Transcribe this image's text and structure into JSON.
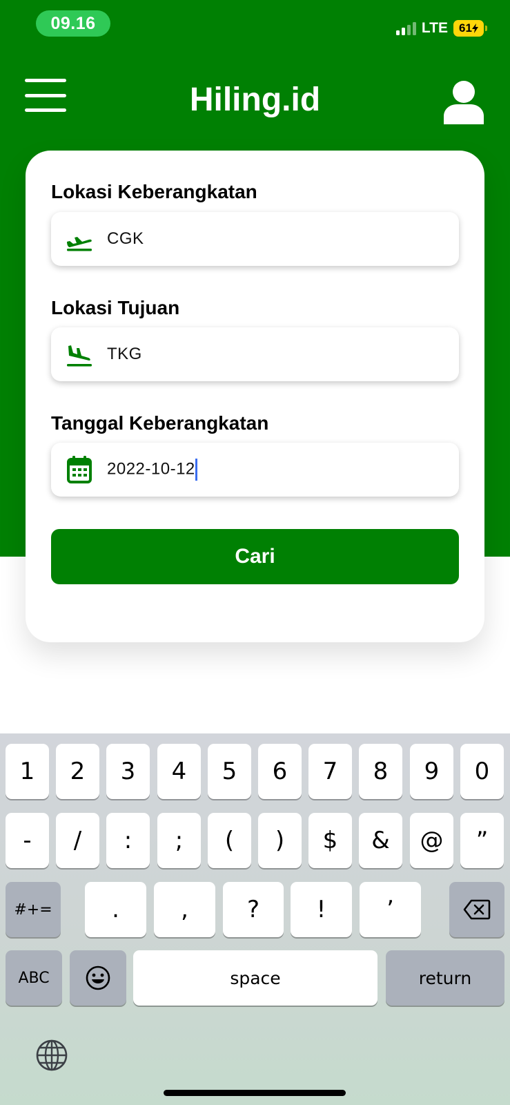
{
  "status_bar": {
    "time": "09.16",
    "network": "LTE",
    "battery": "61"
  },
  "app_bar": {
    "title": "Hiling.id",
    "menu_icon": "hamburger-menu-icon",
    "profile_icon": "user-icon"
  },
  "form": {
    "departure": {
      "label": "Lokasi Keberangkatan",
      "value": "CGK",
      "icon": "plane-takeoff-icon"
    },
    "destination": {
      "label": "Lokasi Tujuan",
      "value": "TKG",
      "icon": "plane-takeoff-icon"
    },
    "date": {
      "label": "Tanggal Keberangkatan",
      "value": "2022-10-12",
      "icon": "calendar-icon"
    },
    "search_button": "Cari"
  },
  "keyboard": {
    "row1": [
      "1",
      "2",
      "3",
      "4",
      "5",
      "6",
      "7",
      "8",
      "9",
      "0"
    ],
    "row2": [
      "-",
      "/",
      ":",
      ";",
      "(",
      ")",
      "$",
      "&",
      "@",
      "”"
    ],
    "row3_mode": "#+=",
    "row3": [
      ".",
      ",",
      "?",
      "!",
      "’"
    ],
    "row3_delete": "delete-icon",
    "row4_abc": "ABC",
    "row4_emoji": "emoji-icon",
    "row4_space": "space",
    "row4_return": "return",
    "globe": "globe-icon"
  },
  "colors": {
    "brand_green": "#008003",
    "time_pill": "#2fc956",
    "battery": "#ffd60a",
    "caret": "#3a6df0"
  }
}
